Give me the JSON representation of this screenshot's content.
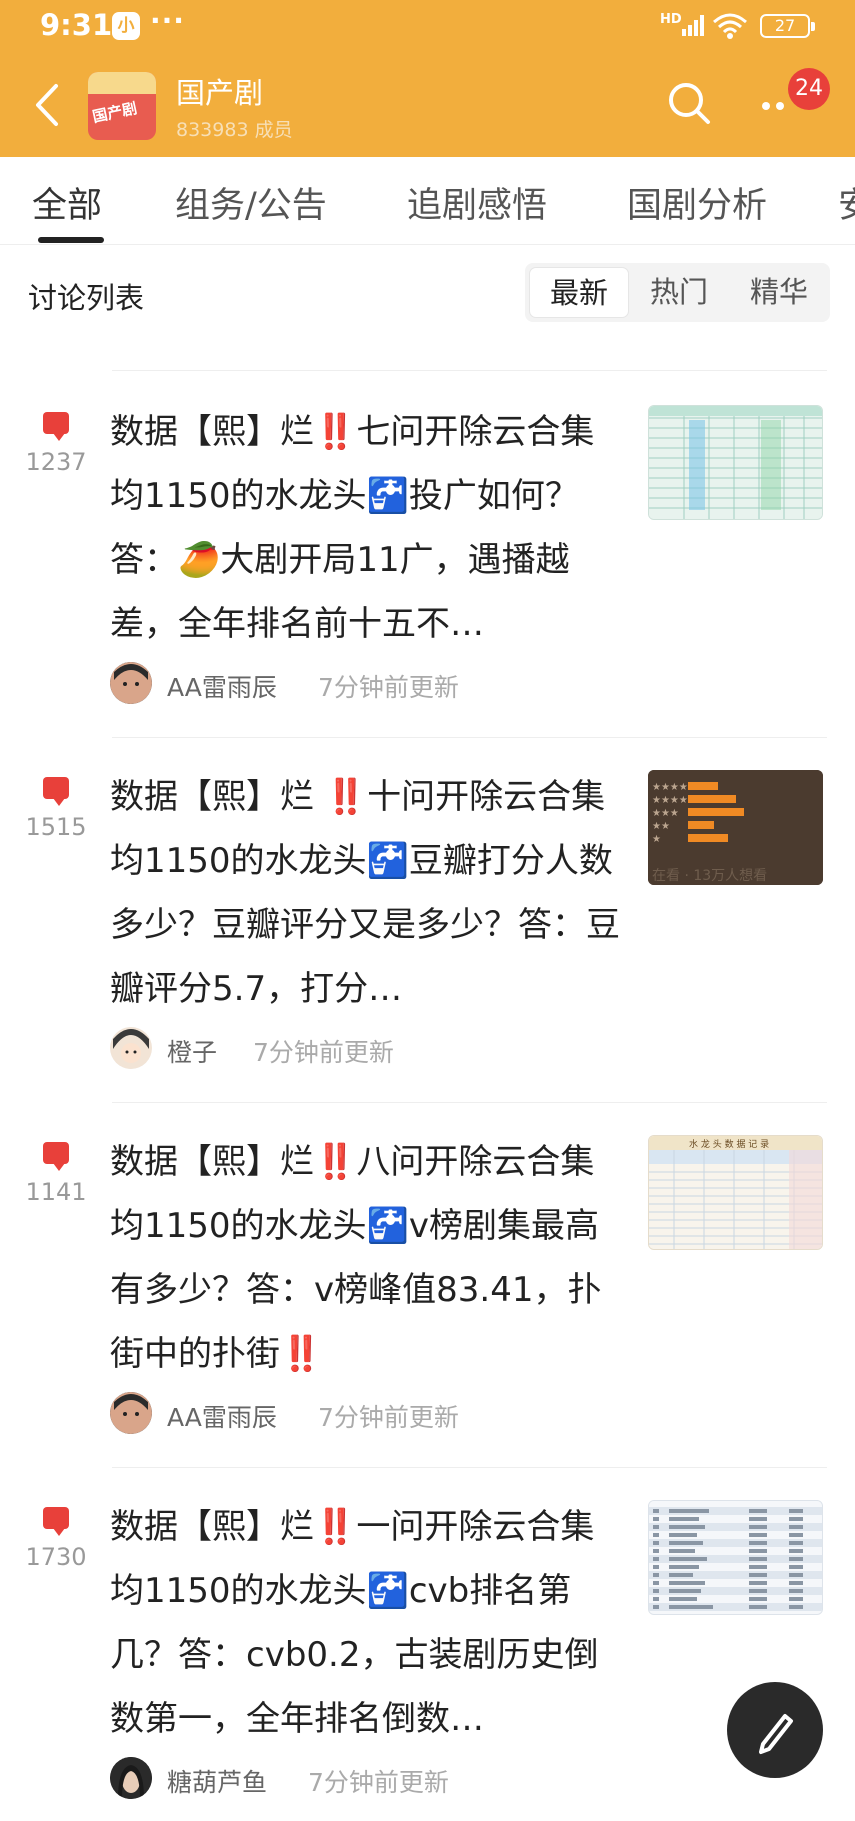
{
  "status_bar": {
    "time": "9:31",
    "app_icon_text": "小",
    "dots": "···",
    "network": "HD",
    "battery": "27"
  },
  "header": {
    "title": "国产剧",
    "members": "833983 成员",
    "avatar_text": "国产剧",
    "notification_count": "24"
  },
  "tabs": [
    {
      "label": "全部"
    },
    {
      "label": "组务/公告"
    },
    {
      "label": "追剧感悟"
    },
    {
      "label": "国剧分析"
    },
    {
      "label": "安"
    }
  ],
  "discussion": {
    "title": "讨论列表",
    "sort": [
      {
        "label": "最新"
      },
      {
        "label": "热门"
      },
      {
        "label": "精华"
      }
    ]
  },
  "posts": [
    {
      "count": "1237",
      "title": "数据【熙】烂‼️七问开除云合集均1150的水龙头🚰投广如何？答：🥭大剧开局11广，遇播越差，全年排名前十五不…",
      "author": "AA雷雨辰",
      "time": "7分钟前更新"
    },
    {
      "count": "1515",
      "title": "数据【熙】烂 ‼️十问开除云合集均1150的水龙头🚰豆瓣打分人数多少？豆瓣评分又是多少？答：豆瓣评分5.7，打分…",
      "author": "橙子",
      "time": "7分钟前更新"
    },
    {
      "count": "1141",
      "title": "数据【熙】烂‼️八问开除云合集均1150的水龙头🚰v榜剧集最高有多少？答：v榜峰值83.41，扑街中的扑街‼️",
      "author": "AA雷雨辰",
      "time": "7分钟前更新"
    },
    {
      "count": "1730",
      "title": "数据【熙】烂‼️一问开除云合集均1150的水龙头🚰cvb排名第几？答：cvb0.2，古装剧历史倒数第一，全年排名倒数…",
      "author": "糖葫芦鱼",
      "time": "7分钟前更新"
    }
  ],
  "thumbnail_text": {
    "post2_caption": "在看 · 13万人想看",
    "post3_header": "水 龙 头 数 据 记 录"
  },
  "colors": {
    "header_bg": "#f2ae3d",
    "accent_red": "#e8403a"
  }
}
